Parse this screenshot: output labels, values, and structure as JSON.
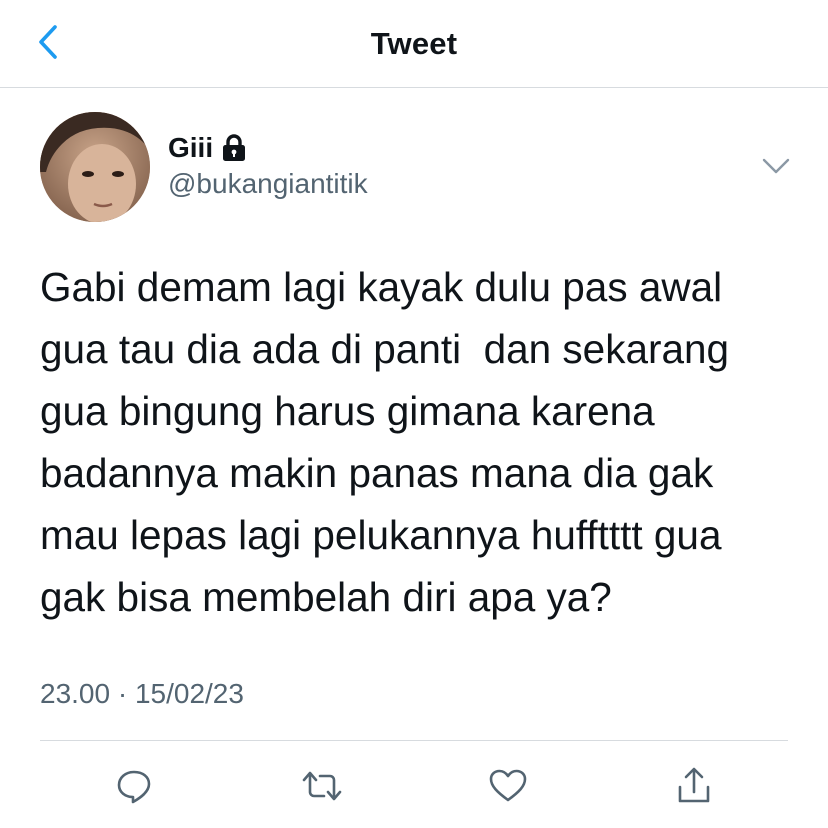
{
  "header": {
    "title": "Tweet",
    "back_icon": "chevron-left-icon",
    "accent_color": "#1d9bf0"
  },
  "author": {
    "display_name": "Giii",
    "handle": "@bukangiantitik",
    "protected_icon": "lock-icon",
    "avatar": "profile-photo"
  },
  "tweet": {
    "lines": [
      "Gabi demam lagi kayak dulu pas awal",
      "gua tau dia ada di panti  dan sekarang",
      "gua bingung harus gimana karena",
      "badannya makin panas mana dia gak",
      "mau lepas lagi pelukannya hufftttt gua",
      "gak bisa membelah diri apa ya?"
    ],
    "timestamp": "23.00 · 15/02/23"
  },
  "actions": [
    {
      "name": "reply",
      "icon": "reply-icon"
    },
    {
      "name": "retweet",
      "icon": "retweet-icon"
    },
    {
      "name": "like",
      "icon": "heart-icon"
    },
    {
      "name": "share",
      "icon": "share-icon"
    }
  ],
  "colors": {
    "text": "#0f1419",
    "secondary": "#536471",
    "divider": "#d7dbdf",
    "accent": "#1d9bf0"
  }
}
